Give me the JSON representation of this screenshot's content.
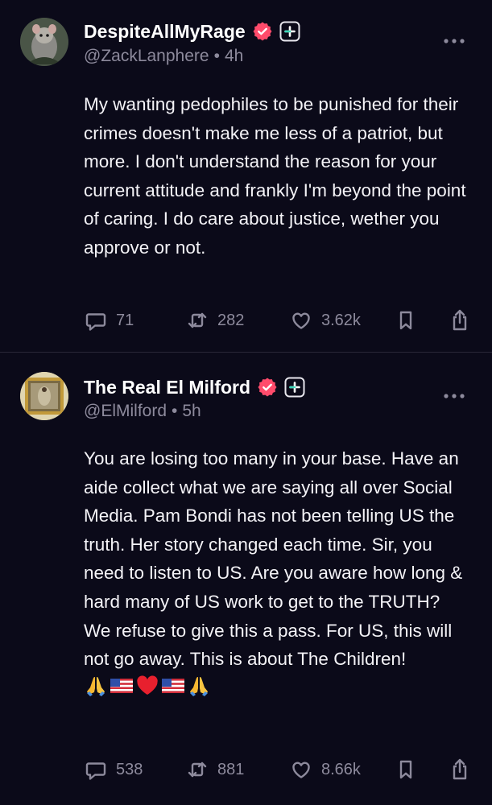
{
  "posts": [
    {
      "display_name": "DespiteAllMyRage",
      "handle": "@ZackLanphere",
      "separator": "•",
      "time": "4h",
      "text": "My wanting pedophiles to be punished for their crimes doesn't make me less of a patriot, but more. I don't understand the reason for your current attitude and frankly I'm beyond the point of caring. I do care about justice, wether you approve or not.",
      "stats": {
        "replies": "71",
        "reposts": "282",
        "likes": "3.62k"
      }
    },
    {
      "display_name": "The Real El Milford",
      "handle": "@ElMilford",
      "separator": "•",
      "time": "5h",
      "text": "You are losing too many in your base. Have an aide collect what we are saying all over Social Media. Pam Bondi has not been telling US the truth. Her story changed each time. Sir, you need to listen to US. Are you aware how long & hard many of US work to get to the TRUTH? We refuse to give this a pass. For US, this will not go away. This is about The Children!",
      "emojis": [
        "folded-hands",
        "us-flag",
        "red-heart",
        "us-flag",
        "folded-hands"
      ],
      "stats": {
        "replies": "538",
        "reposts": "881",
        "likes": "8.66k"
      }
    }
  ],
  "colors": {
    "background": "#0b0a19",
    "text": "#f4f3f7",
    "muted": "#8d8a9c",
    "verified_badge": "#ff4b6b",
    "divider": "#2a2838"
  },
  "icons": [
    "verified-badge-icon",
    "plus-badge-icon",
    "more-icon",
    "reply-icon",
    "repost-icon",
    "heart-icon",
    "bookmark-icon",
    "share-icon"
  ]
}
